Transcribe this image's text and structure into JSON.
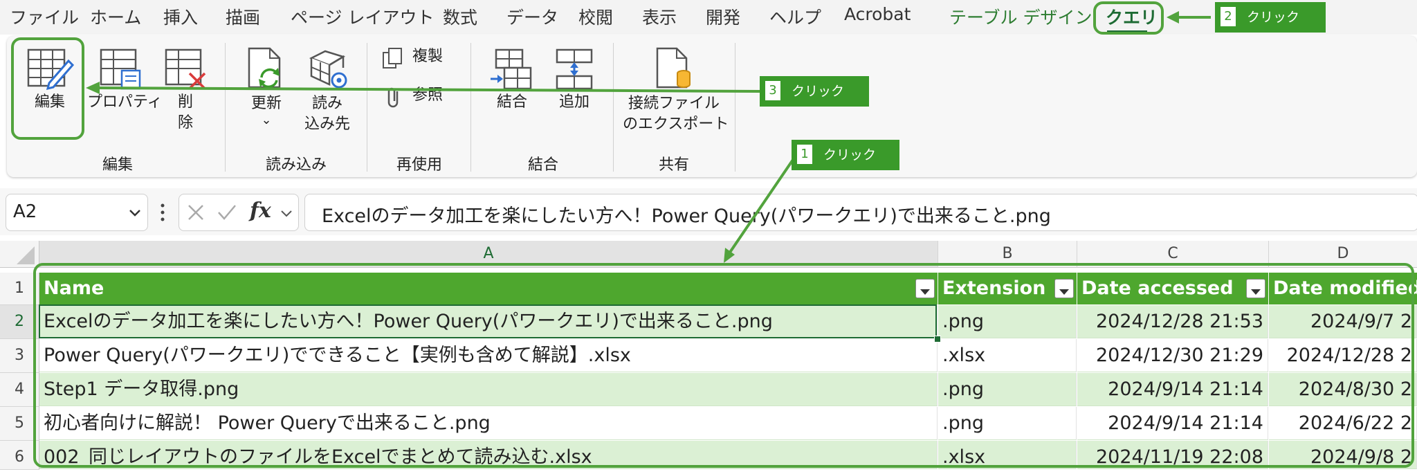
{
  "menu": {
    "file": "ファイル",
    "home": "ホーム",
    "insert": "挿入",
    "draw": "描画",
    "page_layout": "ページ レイアウト",
    "formulas": "数式",
    "data": "データ",
    "review": "校閲",
    "view": "表示",
    "developer": "開発",
    "help": "ヘルプ",
    "acrobat": "Acrobat",
    "table_design": "テーブル デザイン",
    "query": "クエリ"
  },
  "ribbon": {
    "edit_btn": "編集",
    "properties_btn": "プロパティ",
    "delete_btn_1": "削",
    "delete_btn_2": "除",
    "refresh_btn": "更新",
    "refresh_arrow": "⌄",
    "load_to_btn_1": "読み",
    "load_to_btn_2": "込み先",
    "duplicate_btn": "複製",
    "reference_btn": "参照",
    "merge_btn": "結合",
    "append_btn": "追加",
    "export_btn_1": "接続ファイル",
    "export_btn_2": "のエクスポート",
    "group_edit": "編集",
    "group_load": "読み込み",
    "group_reuse": "再使用",
    "group_combine": "結合",
    "group_share": "共有"
  },
  "formula_bar": {
    "name_box": "A2",
    "content": "Excelのデータ加工を楽にしたい方へ！Power Query(パワークエリ)で出来ること.png"
  },
  "grid": {
    "columns": [
      "A",
      "B",
      "C",
      "D"
    ],
    "headers": [
      "Name",
      "Extension",
      "Date accessed",
      "Date modified"
    ],
    "rows": [
      {
        "num": "1"
      },
      {
        "num": "2",
        "name": "Excelのデータ加工を楽にしたい方へ！Power Query(パワークエリ)で出来ること.png",
        "ext": ".png",
        "accessed": "2024/12/28 21:53",
        "modified": "2024/9/7 2"
      },
      {
        "num": "3",
        "name": "Power Query(パワークエリ)でできること【実例も含めて解説】.xlsx",
        "ext": ".xlsx",
        "accessed": "2024/12/30 21:29",
        "modified": "2024/12/28 2"
      },
      {
        "num": "4",
        "name": "Step1 データ取得.png",
        "ext": ".png",
        "accessed": "2024/9/14 21:14",
        "modified": "2024/8/30 2"
      },
      {
        "num": "5",
        "name": "初心者向けに解説！ Power Queryで出来ること.png",
        "ext": ".png",
        "accessed": "2024/9/14 21:14",
        "modified": "2024/6/22 2"
      },
      {
        "num": "6",
        "name": "002_同じレイアウトのファイルをExcelでまとめて読み込む.xlsx",
        "ext": ".xlsx",
        "accessed": "2024/11/19 22:08",
        "modified": "2024/9/8 2"
      }
    ]
  },
  "annotations": {
    "c1": {
      "num": "1",
      "text": "クリック"
    },
    "c2": {
      "num": "2",
      "text": "クリック"
    },
    "c3": {
      "num": "3",
      "text": "クリック"
    }
  },
  "colors": {
    "accent": "#4ea72e",
    "annotation": "#3a9a2a",
    "band": "#dbf0d4"
  }
}
